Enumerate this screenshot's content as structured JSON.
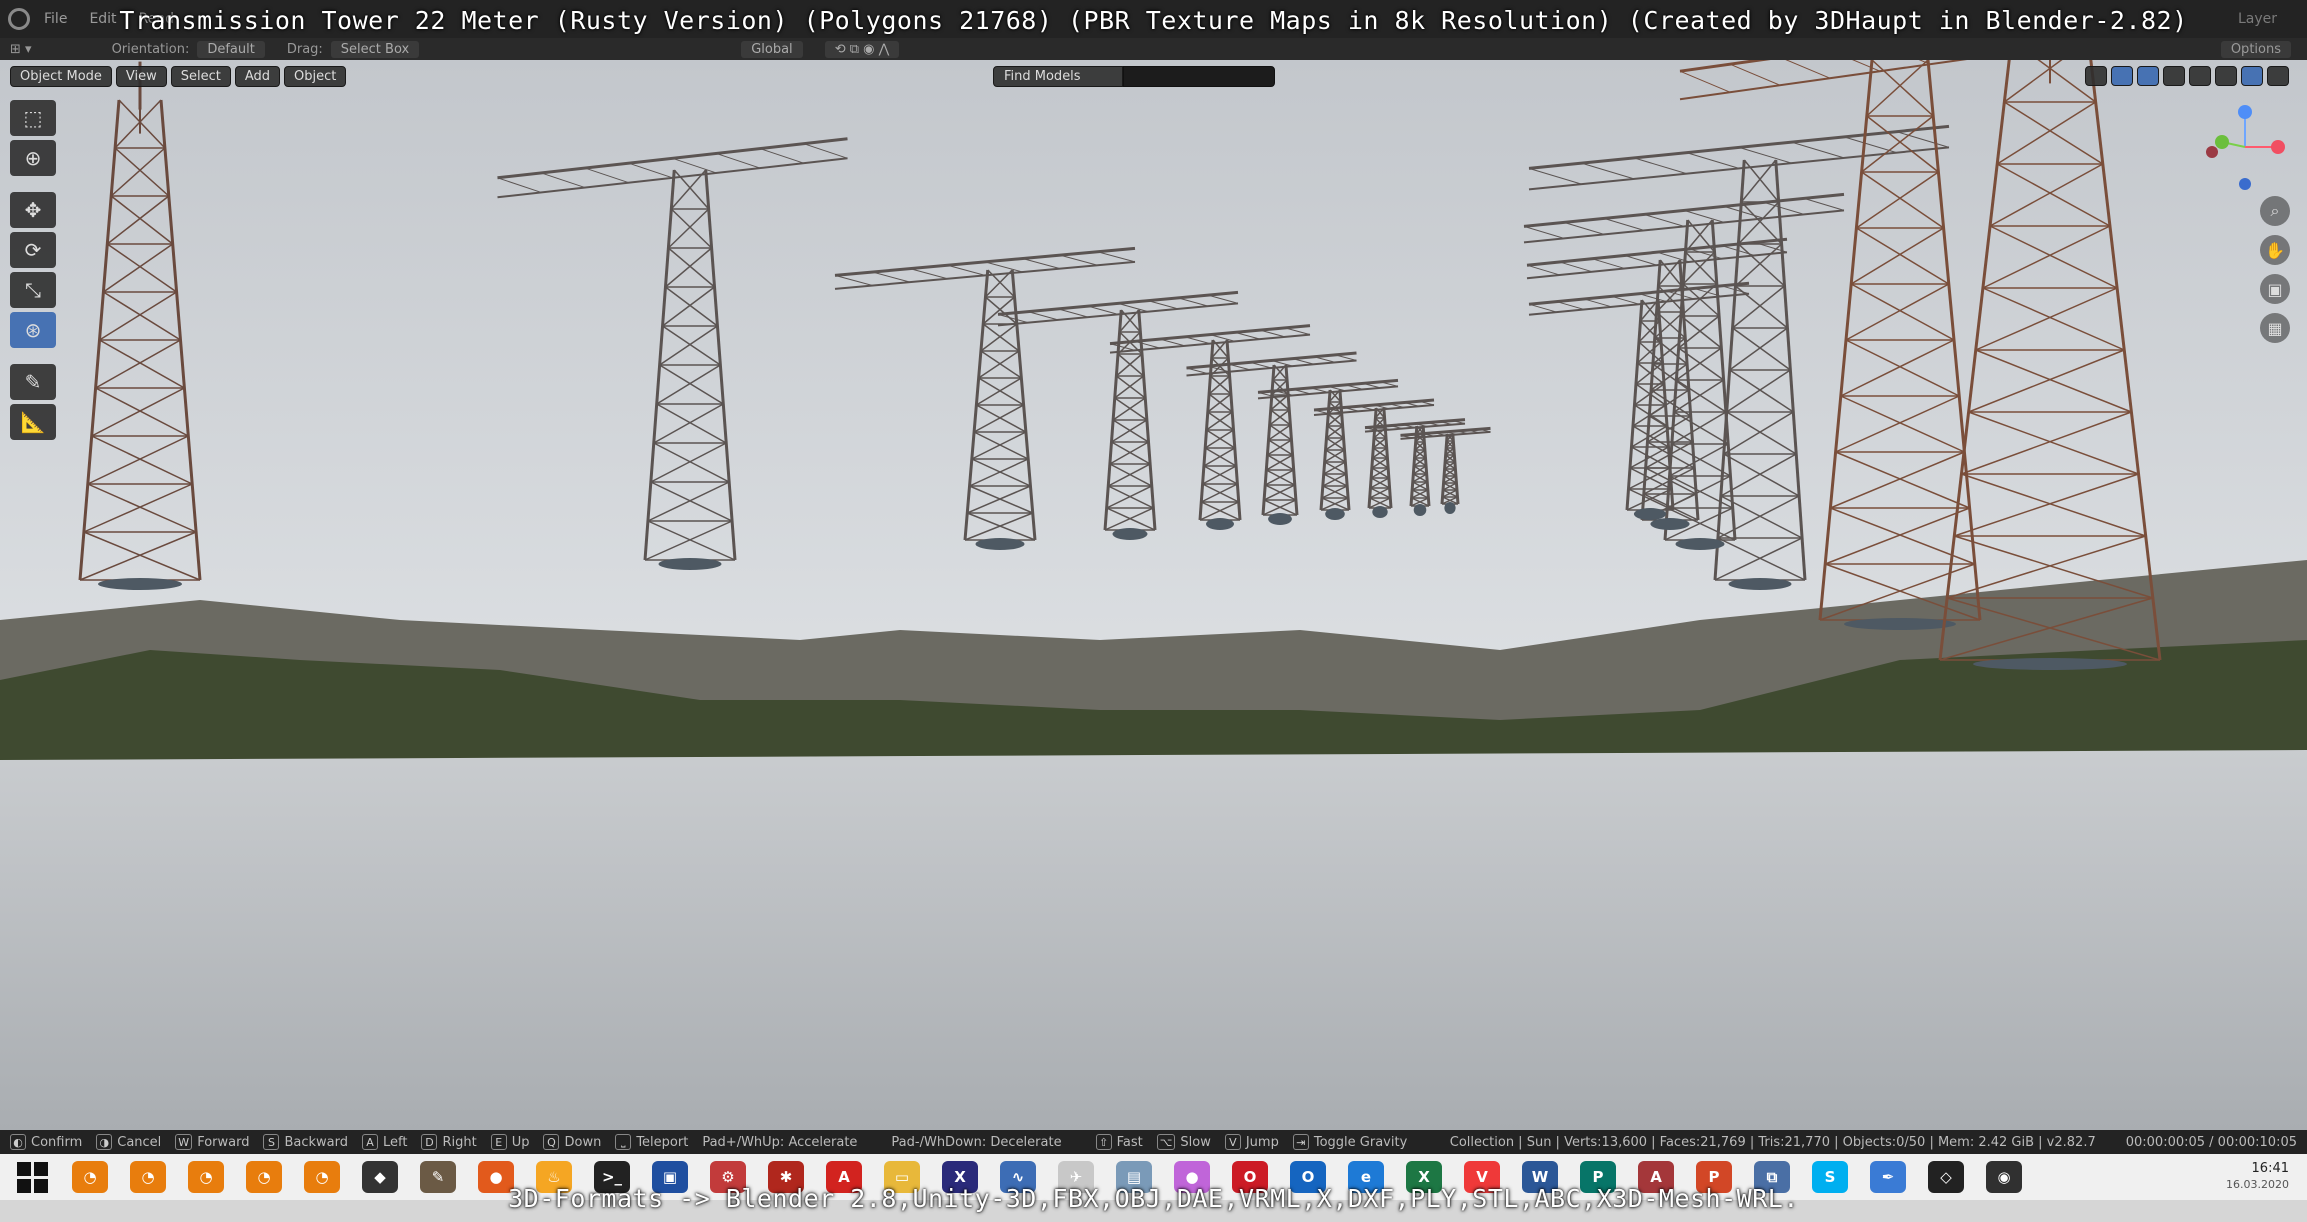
{
  "overlay": {
    "title": "Transmission Tower 22 Meter (Rusty Version) (Polygons 21768) (PBR Texture Maps in 8k Resolution) (Created by 3DHaupt in Blender-2.82)",
    "formats": "3D-Formats -> Blender 2.8,Unity-3D,FBX,OBJ,DAE,VRML,X,DXF,PLY,STL,ABC,X3D-Mesh-WRL."
  },
  "menubar": {
    "items": [
      "File",
      "Edit",
      "Rend"
    ],
    "right": [
      "Layer"
    ]
  },
  "header": {
    "orientation_label": "Orientation:",
    "orientation_value": "Default",
    "drag_label": "Drag:",
    "drag_value": "Select Box",
    "transform_space": "Global",
    "options": "Options"
  },
  "viewport": {
    "mode": "Object Mode",
    "menus": [
      "View",
      "Select",
      "Add",
      "Object"
    ],
    "find_models": "Find Models",
    "search_value": ""
  },
  "statusbar": {
    "hints": [
      {
        "key": "",
        "label": "Confirm"
      },
      {
        "key": "",
        "label": "Cancel"
      },
      {
        "key": "W",
        "label": "Forward"
      },
      {
        "key": "S",
        "label": "Backward"
      },
      {
        "key": "A",
        "label": "Left"
      },
      {
        "key": "D",
        "label": "Right"
      },
      {
        "key": "E",
        "label": "Up"
      },
      {
        "key": "Q",
        "label": "Down"
      },
      {
        "key": "",
        "label": "Teleport"
      }
    ],
    "accelerate": "Pad+/WhUp: Accelerate",
    "decelerate": "Pad-/WhDown: Decelerate",
    "hints2": [
      {
        "key": "⇧",
        "label": "Fast"
      },
      {
        "key": "⌥",
        "label": "Slow"
      },
      {
        "key": "V",
        "label": "Jump"
      },
      {
        "key": "",
        "label": "Toggle Gravity"
      }
    ],
    "stats": "Collection | Sun | Verts:13,600 | Faces:21,769 | Tris:21,770 | Objects:0/50 | Mem: 2.42 GiB | v2.82.7",
    "timecode": "00:00:00:05 / 00:00:10:05"
  },
  "taskbar": {
    "time": "16:41",
    "date": "16.03.2020",
    "apps": [
      {
        "name": "blender-icon-1",
        "color": "#e87d0d",
        "glyph": "◔"
      },
      {
        "name": "blender-icon-2",
        "color": "#e87d0d",
        "glyph": "◔"
      },
      {
        "name": "blender-icon-3",
        "color": "#e87d0d",
        "glyph": "◔"
      },
      {
        "name": "blender-icon-4",
        "color": "#e87d0d",
        "glyph": "◔"
      },
      {
        "name": "blender-icon-5",
        "color": "#e87d0d",
        "glyph": "◔"
      },
      {
        "name": "unity-icon",
        "color": "#333333",
        "glyph": "◆"
      },
      {
        "name": "gimp-icon",
        "color": "#6b5a45",
        "glyph": "✎"
      },
      {
        "name": "firefox-icon",
        "color": "#e25a1c",
        "glyph": "●"
      },
      {
        "name": "flame-icon",
        "color": "#f5a623",
        "glyph": "♨"
      },
      {
        "name": "terminal-icon",
        "color": "#222222",
        "glyph": ">_"
      },
      {
        "name": "save-disk-icon",
        "color": "#1f4fa0",
        "glyph": "▣"
      },
      {
        "name": "tool-icon",
        "color": "#c23b3b",
        "glyph": "⚙"
      },
      {
        "name": "bug-icon",
        "color": "#b0271d",
        "glyph": "✱"
      },
      {
        "name": "acrobat-icon",
        "color": "#d2231f",
        "glyph": "A"
      },
      {
        "name": "folder-icon",
        "color": "#e8b83a",
        "glyph": "▭"
      },
      {
        "name": "xnview-icon",
        "color": "#2a2a7a",
        "glyph": "X"
      },
      {
        "name": "chart-app-icon",
        "color": "#3d6db5",
        "glyph": "∿"
      },
      {
        "name": "plane-app-icon",
        "color": "#c8c8c8",
        "glyph": "✈"
      },
      {
        "name": "box-app-icon",
        "color": "#7a9ab8",
        "glyph": "▤"
      },
      {
        "name": "balloon-app-icon",
        "color": "#c065d9",
        "glyph": "●"
      },
      {
        "name": "opera-icon",
        "color": "#cc1b25",
        "glyph": "O"
      },
      {
        "name": "outlook-icon",
        "color": "#1565c0",
        "glyph": "O"
      },
      {
        "name": "edge-icon",
        "color": "#1e7ad6",
        "glyph": "e"
      },
      {
        "name": "excel-icon",
        "color": "#1d7744",
        "glyph": "X"
      },
      {
        "name": "vivaldi-icon",
        "color": "#ef3939",
        "glyph": "V"
      },
      {
        "name": "word-icon",
        "color": "#2b5797",
        "glyph": "W"
      },
      {
        "name": "publisher-icon",
        "color": "#077568",
        "glyph": "P"
      },
      {
        "name": "access-icon",
        "color": "#a4373a",
        "glyph": "A"
      },
      {
        "name": "powerpoint-icon",
        "color": "#d24726",
        "glyph": "P"
      },
      {
        "name": "network-icon",
        "color": "#4a6fa5",
        "glyph": "⧉"
      },
      {
        "name": "skype-icon",
        "color": "#00aff0",
        "glyph": "S"
      },
      {
        "name": "pen-app-icon",
        "color": "#3a7bd5",
        "glyph": "✒"
      },
      {
        "name": "unity-hub-icon",
        "color": "#222222",
        "glyph": "◇"
      },
      {
        "name": "obs-icon",
        "color": "#303030",
        "glyph": "◉"
      }
    ]
  }
}
